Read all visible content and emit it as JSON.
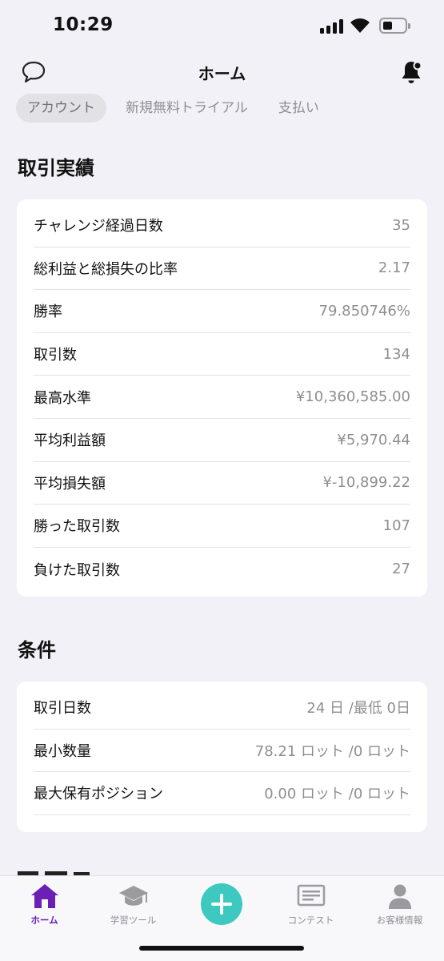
{
  "status_bar": {
    "time": "10:29"
  },
  "header": {
    "title": "ホーム"
  },
  "tabs": [
    {
      "label": "アカウント",
      "active": true
    },
    {
      "label": "新規無料トライアル",
      "active": false
    },
    {
      "label": "支払い",
      "active": false
    }
  ],
  "trading": {
    "title": "取引実績",
    "rows": [
      {
        "label": "チャレンジ経過日数",
        "value": "35"
      },
      {
        "label": "総利益と総損失の比率",
        "value": "2.17"
      },
      {
        "label": "勝率",
        "value": "79.850746%"
      },
      {
        "label": "取引数",
        "value": "134"
      },
      {
        "label": "最高水準",
        "value": "¥10,360,585.00"
      },
      {
        "label": "平均利益額",
        "value": "¥5,970.44"
      },
      {
        "label": "平均損失額",
        "value": "¥-10,899.22"
      },
      {
        "label": "勝った取引数",
        "value": "107"
      },
      {
        "label": "負けた取引数",
        "value": "27"
      }
    ]
  },
  "conditions": {
    "title": "条件",
    "rows": [
      {
        "label": "取引日数",
        "value": "24 日 /最低 0日"
      },
      {
        "label": "最小数量",
        "value": "78.21 ロット /0 ロット"
      },
      {
        "label": "最大保有ポジション",
        "value": "0.00 ロット /0 ロット"
      }
    ]
  },
  "bottom_nav": [
    {
      "label": "ホーム",
      "icon": "home-icon",
      "active": true
    },
    {
      "label": "学習ツール",
      "icon": "graduation-cap-icon",
      "active": false
    },
    {
      "label": "",
      "icon": "plus-icon",
      "active": false
    },
    {
      "label": "コンテスト",
      "icon": "contest-board-icon",
      "active": false
    },
    {
      "label": "お客様情報",
      "icon": "person-icon",
      "active": false
    }
  ],
  "colors": {
    "background": "#f2f1f7",
    "accent_purple": "#6a1fb5",
    "fab_teal": "#3ec9c0",
    "muted_text": "#8e8e93"
  }
}
